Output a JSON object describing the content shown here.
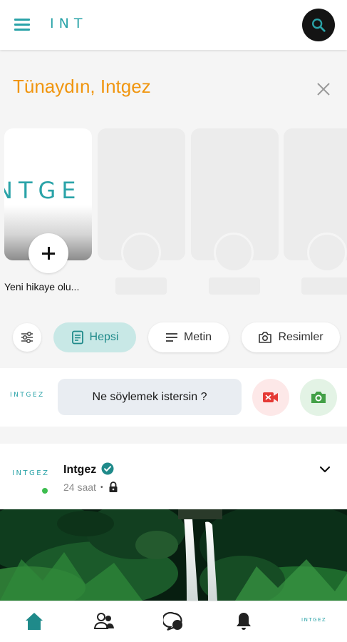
{
  "app": {
    "logo_text": "INT",
    "brand_color": "#2aa3a8",
    "accent_color": "#f0950e"
  },
  "header": {
    "menu_icon": "menu-icon",
    "search_icon": "search-icon"
  },
  "greeting": {
    "text": "Tünaydın, Intgez"
  },
  "stories": {
    "create": {
      "logo_text": "NTGE",
      "label": "Yeni hikaye olu..."
    },
    "placeholders": 3
  },
  "filters": {
    "settings_icon": "tune-icon",
    "chips": [
      {
        "label": "Hepsi",
        "icon": "document-icon",
        "active": true
      },
      {
        "label": "Metin",
        "icon": "text-lines-icon",
        "active": false
      },
      {
        "label": "Resimler",
        "icon": "camera-icon",
        "active": false
      }
    ]
  },
  "composer": {
    "logo_text": "INTGEZ",
    "placeholder": "Ne söylemek istersin ?",
    "video_icon": "video-camera-icon",
    "photo_icon": "photo-camera-icon"
  },
  "post": {
    "avatar_logo": "INTGEZ",
    "author": "Intgez",
    "verified": true,
    "time": "24 saat",
    "separator": "•",
    "privacy_icon": "lock-icon",
    "image_desc": "waterfall-jungle"
  },
  "bottom_nav": {
    "items": [
      "home-icon",
      "friends-icon",
      "messages-icon",
      "notifications-icon"
    ],
    "profile_logo": "INTGEZ"
  }
}
